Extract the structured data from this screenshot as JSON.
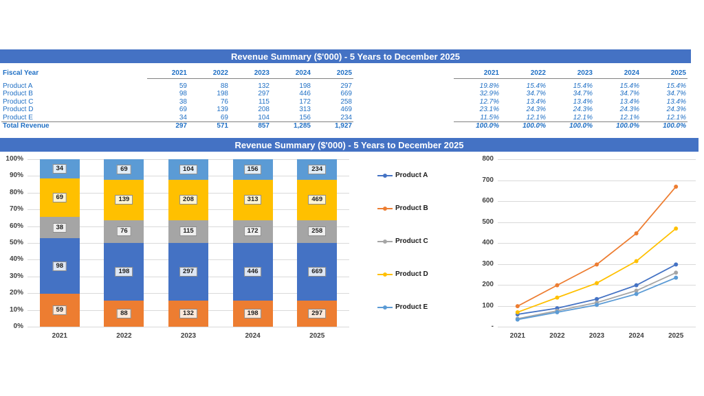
{
  "banners": {
    "top": "Revenue Summary ($'000) - 5 Years to December 2025",
    "middle": "Revenue Summary ($'000) - 5 Years to December 2025"
  },
  "value_table": {
    "row_header": "Fiscal Year",
    "years": [
      "2021",
      "2022",
      "2023",
      "2024",
      "2025"
    ],
    "rows": [
      {
        "label": "Product A",
        "values": [
          "59",
          "88",
          "132",
          "198",
          "297"
        ]
      },
      {
        "label": "Product B",
        "values": [
          "98",
          "198",
          "297",
          "446",
          "669"
        ]
      },
      {
        "label": "Product C",
        "values": [
          "38",
          "76",
          "115",
          "172",
          "258"
        ]
      },
      {
        "label": "Product D",
        "values": [
          "69",
          "139",
          "208",
          "313",
          "469"
        ]
      },
      {
        "label": "Product E",
        "values": [
          "34",
          "69",
          "104",
          "156",
          "234"
        ]
      }
    ],
    "total": {
      "label": "Total Revenue",
      "values": [
        "297",
        "571",
        "857",
        "1,285",
        "1,927"
      ]
    }
  },
  "percent_table": {
    "years": [
      "2021",
      "2022",
      "2023",
      "2024",
      "2025"
    ],
    "rows": [
      {
        "label": "Product A",
        "values": [
          "19.8%",
          "15.4%",
          "15.4%",
          "15.4%",
          "15.4%"
        ]
      },
      {
        "label": "Product B",
        "values": [
          "32.9%",
          "34.7%",
          "34.7%",
          "34.7%",
          "34.7%"
        ]
      },
      {
        "label": "Product C",
        "values": [
          "12.7%",
          "13.4%",
          "13.4%",
          "13.4%",
          "13.4%"
        ]
      },
      {
        "label": "Product D",
        "values": [
          "23.1%",
          "24.3%",
          "24.3%",
          "24.3%",
          "24.3%"
        ]
      },
      {
        "label": "Product E",
        "values": [
          "11.5%",
          "12.1%",
          "12.1%",
          "12.1%",
          "12.1%"
        ]
      }
    ],
    "total": {
      "values": [
        "100.0%",
        "100.0%",
        "100.0%",
        "100.0%",
        "100.0%"
      ]
    }
  },
  "colors": {
    "banner": "#4472c4",
    "table_text": "#1f6fc4",
    "product_a": "#4472c4",
    "product_b": "#ed7d31",
    "product_c": "#a5a5a5",
    "product_d": "#ffc000",
    "product_e": "#5b9bd5",
    "gridline": "#d9d9d9"
  },
  "chart_data": [
    {
      "type": "bar",
      "title": "Revenue Summary ($'000) - 5 Years to December 2025",
      "stacked": true,
      "normalized": true,
      "categories": [
        "2021",
        "2022",
        "2023",
        "2024",
        "2025"
      ],
      "series": [
        {
          "name": "Product A",
          "color": "#ed7d31",
          "values": [
            59,
            88,
            132,
            198,
            297
          ],
          "labels": [
            "59",
            "88",
            "132",
            "198",
            "297"
          ],
          "percents": [
            19.8,
            15.4,
            15.4,
            15.4,
            15.4
          ]
        },
        {
          "name": "Product B",
          "color": "#4472c4",
          "values": [
            98,
            198,
            297,
            446,
            669
          ],
          "labels": [
            "98",
            "198",
            "297",
            "446",
            "669"
          ],
          "percents": [
            32.9,
            34.7,
            34.7,
            34.7,
            34.7
          ]
        },
        {
          "name": "Product C",
          "color": "#a5a5a5",
          "values": [
            38,
            76,
            115,
            172,
            258
          ],
          "labels": [
            "38",
            "76",
            "115",
            "172",
            "258"
          ],
          "percents": [
            12.7,
            13.4,
            13.4,
            13.4,
            13.4
          ]
        },
        {
          "name": "Product D",
          "color": "#ffc000",
          "values": [
            69,
            139,
            208,
            313,
            469
          ],
          "labels": [
            "69",
            "139",
            "208",
            "313",
            "469"
          ],
          "percents": [
            23.1,
            24.3,
            24.3,
            24.3,
            24.3
          ]
        },
        {
          "name": "Product E",
          "color": "#5b9bd5",
          "values": [
            34,
            69,
            104,
            156,
            234
          ],
          "labels": [
            "34",
            "69",
            "104",
            "156",
            "234"
          ],
          "percents": [
            11.5,
            12.1,
            12.1,
            12.1,
            12.1
          ]
        }
      ],
      "yticks": [
        "0%",
        "10%",
        "20%",
        "30%",
        "40%",
        "50%",
        "60%",
        "70%",
        "80%",
        "90%",
        "100%"
      ],
      "ylim": [
        0,
        100
      ],
      "xlabel": "",
      "ylabel": "",
      "grid": true,
      "legend": false
    },
    {
      "type": "line",
      "title": "Revenue Summary ($'000) - 5 Years to December 2025",
      "x": [
        "2021",
        "2022",
        "2023",
        "2024",
        "2025"
      ],
      "series": [
        {
          "name": "Product A",
          "color": "#4472c4",
          "values": [
            59,
            88,
            132,
            198,
            297
          ]
        },
        {
          "name": "Product B",
          "color": "#ed7d31",
          "values": [
            98,
            198,
            297,
            446,
            669
          ]
        },
        {
          "name": "Product C",
          "color": "#a5a5a5",
          "values": [
            38,
            76,
            115,
            172,
            258
          ]
        },
        {
          "name": "Product D",
          "color": "#ffc000",
          "values": [
            69,
            139,
            208,
            313,
            469
          ]
        },
        {
          "name": "Product E",
          "color": "#5b9bd5",
          "values": [
            34,
            69,
            104,
            156,
            234
          ]
        }
      ],
      "yticks": [
        "-",
        "100",
        "200",
        "300",
        "400",
        "500",
        "600",
        "700",
        "800"
      ],
      "ylim": [
        0,
        800
      ],
      "xlabel": "",
      "ylabel": "",
      "grid": true,
      "legend": true,
      "legend_position": "left",
      "legend_entries": [
        "Product A",
        "Product B",
        "Product C",
        "Product D",
        "Product E"
      ]
    }
  ]
}
